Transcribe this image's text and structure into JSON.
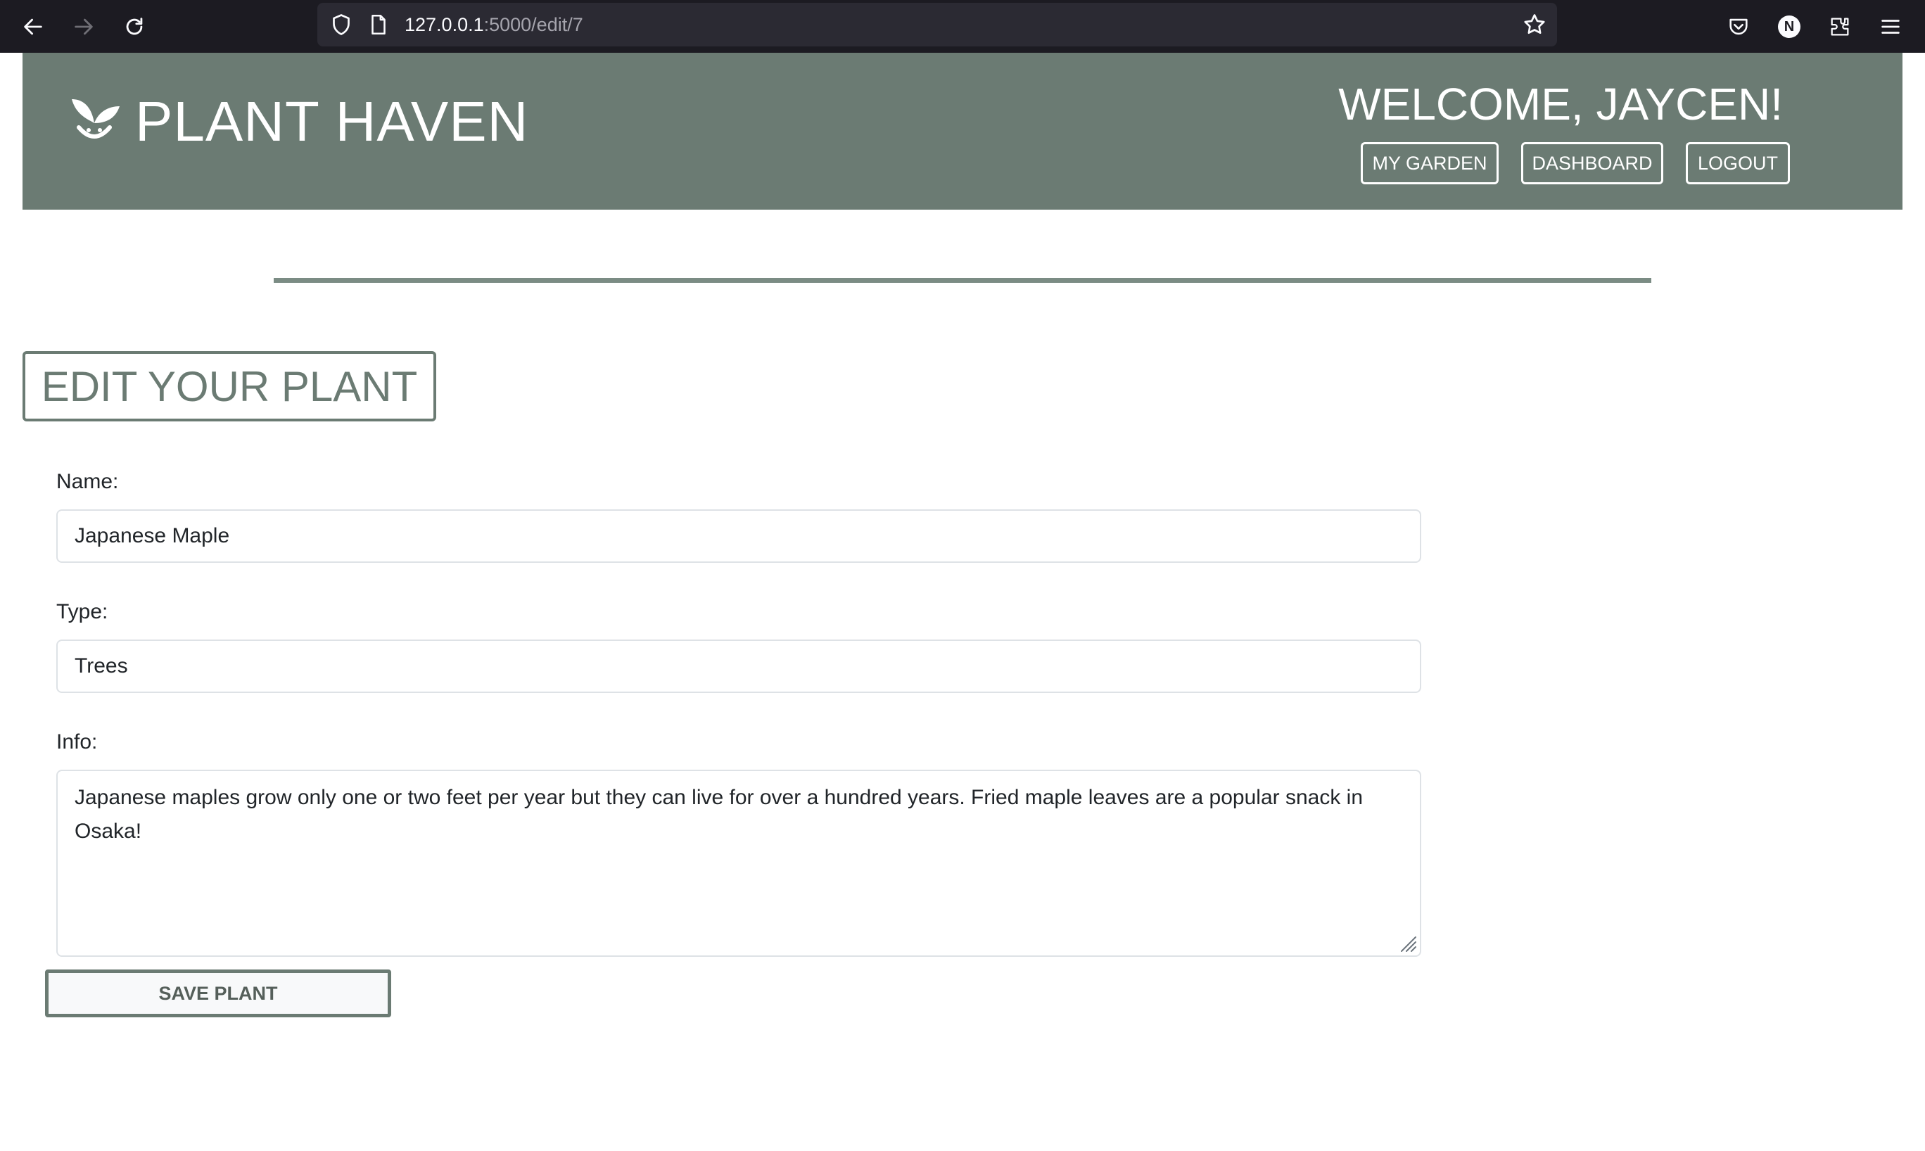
{
  "browser": {
    "url_host": "127.0.0.1",
    "url_path": ":5000/edit/7",
    "profile_initial": "N"
  },
  "header": {
    "site_title": "PLANT HAVEN",
    "welcome": "WELCOME, JAYCEN!",
    "nav": {
      "my_garden": "MY GARDEN",
      "dashboard": "DASHBOARD",
      "logout": "LOGOUT"
    },
    "header_color": "#6b7b73"
  },
  "page": {
    "title": "EDIT YOUR PLANT"
  },
  "form": {
    "name_label": "Name:",
    "name_value": "Japanese Maple",
    "type_label": "Type:",
    "type_value": "Trees",
    "info_label": "Info:",
    "info_value": "Japanese maples grow only one or two feet per year but they can live for over a hundred years. Fried maple leaves are a popular snack in Osaka!",
    "save_label": "SAVE PLANT"
  },
  "icons": [
    "back-arrow-icon",
    "forward-arrow-icon",
    "reload-icon",
    "shield-icon",
    "page-icon",
    "bookmark-star-icon",
    "pocket-icon",
    "extensions-icon",
    "menu-icon",
    "leaf-logo-icon",
    "resize-handle-icon"
  ]
}
